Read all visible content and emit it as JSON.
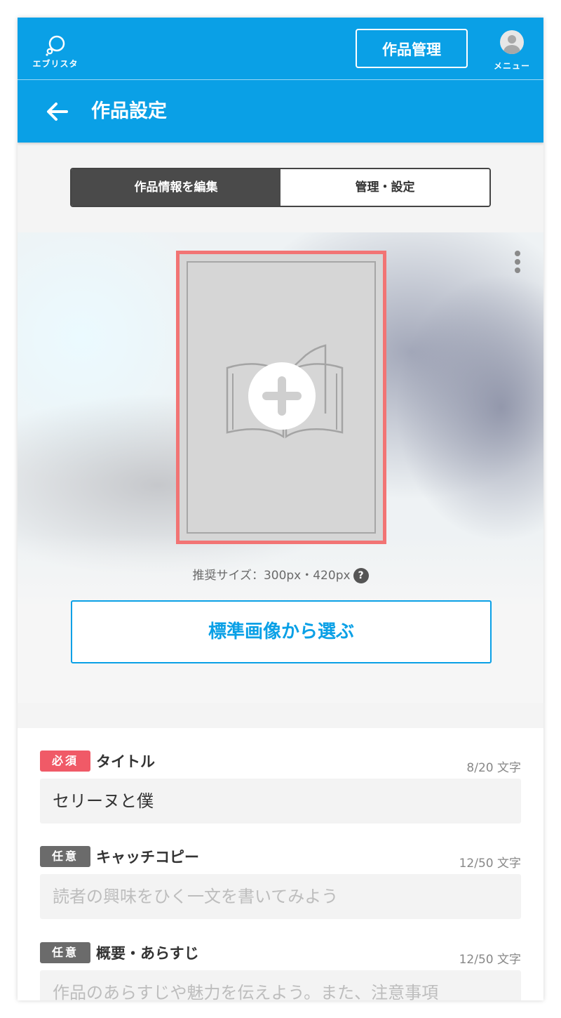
{
  "header": {
    "logo_text": "エブリスタ",
    "manage_label": "作品管理",
    "menu_label": "メニュー"
  },
  "title_bar": {
    "title": "作品設定"
  },
  "tabs": [
    {
      "label": "作品情報を編集",
      "active": true
    },
    {
      "label": "管理・設定",
      "active": false
    }
  ],
  "cover": {
    "size_note": "推奨サイズ：300px・420px",
    "help_glyph": "?",
    "standard_image_button": "標準画像から選ぶ"
  },
  "form": {
    "fields": [
      {
        "badge": "必須",
        "label": "タイトル",
        "count": "8/20 文字",
        "value": "セリーヌと僕",
        "placeholder": ""
      },
      {
        "badge": "任意",
        "label": "キャッチコピー",
        "count": "12/50 文字",
        "value": "",
        "placeholder": "読者の興味をひく一文を書いてみよう"
      },
      {
        "badge": "任意",
        "label": "概要・あらすじ",
        "count": "12/50 文字",
        "value": "",
        "placeholder": "作品のあらすじや魅力を伝えよう。また、注意事項"
      }
    ]
  },
  "colors": {
    "brand_blue": "#0aa0e6",
    "required_red": "#f05a67",
    "cover_border": "#f27474"
  }
}
